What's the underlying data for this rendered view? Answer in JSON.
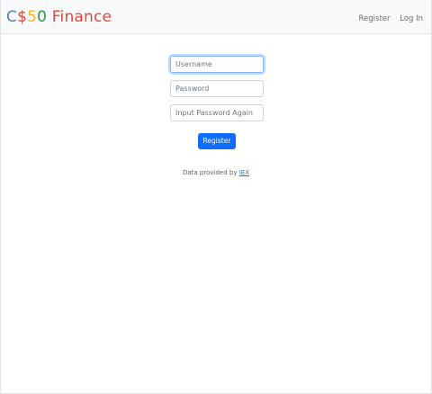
{
  "brand": {
    "parts": [
      {
        "text": "C",
        "color": "#537fbe"
      },
      {
        "text": "$",
        "color": "#ea433b"
      },
      {
        "text": "5",
        "color": "#f5b82e"
      },
      {
        "text": "0",
        "color": "#2e944b"
      },
      {
        "text": " Finance",
        "color": "#ea433b"
      }
    ]
  },
  "nav": {
    "register": "Register",
    "login": "Log In"
  },
  "form": {
    "username_placeholder": "Username",
    "username_value": "",
    "password_placeholder": "Password",
    "password_value": "",
    "confirm_placeholder": "Input Password Again",
    "confirm_value": "",
    "submit_label": "Register"
  },
  "footer": {
    "prefix": "Data provided by ",
    "link_text": "IEX"
  },
  "colors": {
    "primary": "#0d6efd",
    "navbar_bg": "#f8f9fa"
  }
}
